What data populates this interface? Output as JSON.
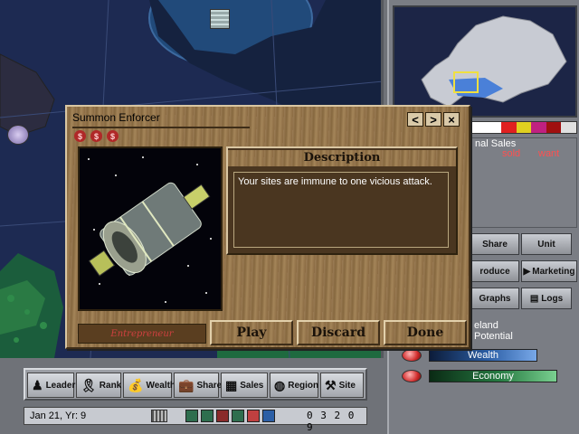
{
  "dialog": {
    "title": "Summon Enforcer",
    "cost_symbols": [
      "$",
      "$",
      "$"
    ],
    "description_heading": "Description",
    "description_text": "Your sites are immune to one vicious attack.",
    "image": "satellite-image",
    "level_label": "Entrepreneur",
    "buttons": {
      "play": "Play",
      "discard": "Discard",
      "done": "Done"
    },
    "nav": {
      "prev": "<",
      "next": ">",
      "close": "×"
    }
  },
  "right_panel": {
    "sales_title": "nal Sales",
    "sold_label": "sold",
    "want_label": "want",
    "buttons": {
      "share": "Share",
      "unit": "Unit",
      "produce": "roduce",
      "marketing": "Marketing",
      "graphs": "Graphs",
      "logs": "Logs"
    },
    "region_name": "eland",
    "potential_label": "Potential",
    "bars": [
      {
        "label": "Wealth",
        "color": "#3d7fd0"
      },
      {
        "label": "Economy",
        "color": "#2f9a52"
      }
    ],
    "palette": [
      "#ffffff",
      "#e02020",
      "#e0d020",
      "#c02080",
      "#a01010",
      "#e0e0e0"
    ]
  },
  "toolbar": {
    "items": [
      {
        "label": "Leader",
        "icon": "person-icon"
      },
      {
        "label": "Rank",
        "icon": "ribbon-icon"
      },
      {
        "label": "Wealth",
        "icon": "money-bag-icon"
      },
      {
        "label": "Share",
        "icon": "briefcase-icon"
      },
      {
        "label": "Sales",
        "icon": "register-icon"
      },
      {
        "label": "Region",
        "icon": "globe-icon"
      },
      {
        "label": "Site",
        "icon": "crane-icon"
      }
    ]
  },
  "status": {
    "date": "Jan 21, Yr: 9",
    "money": "0 3 2 0 9"
  }
}
